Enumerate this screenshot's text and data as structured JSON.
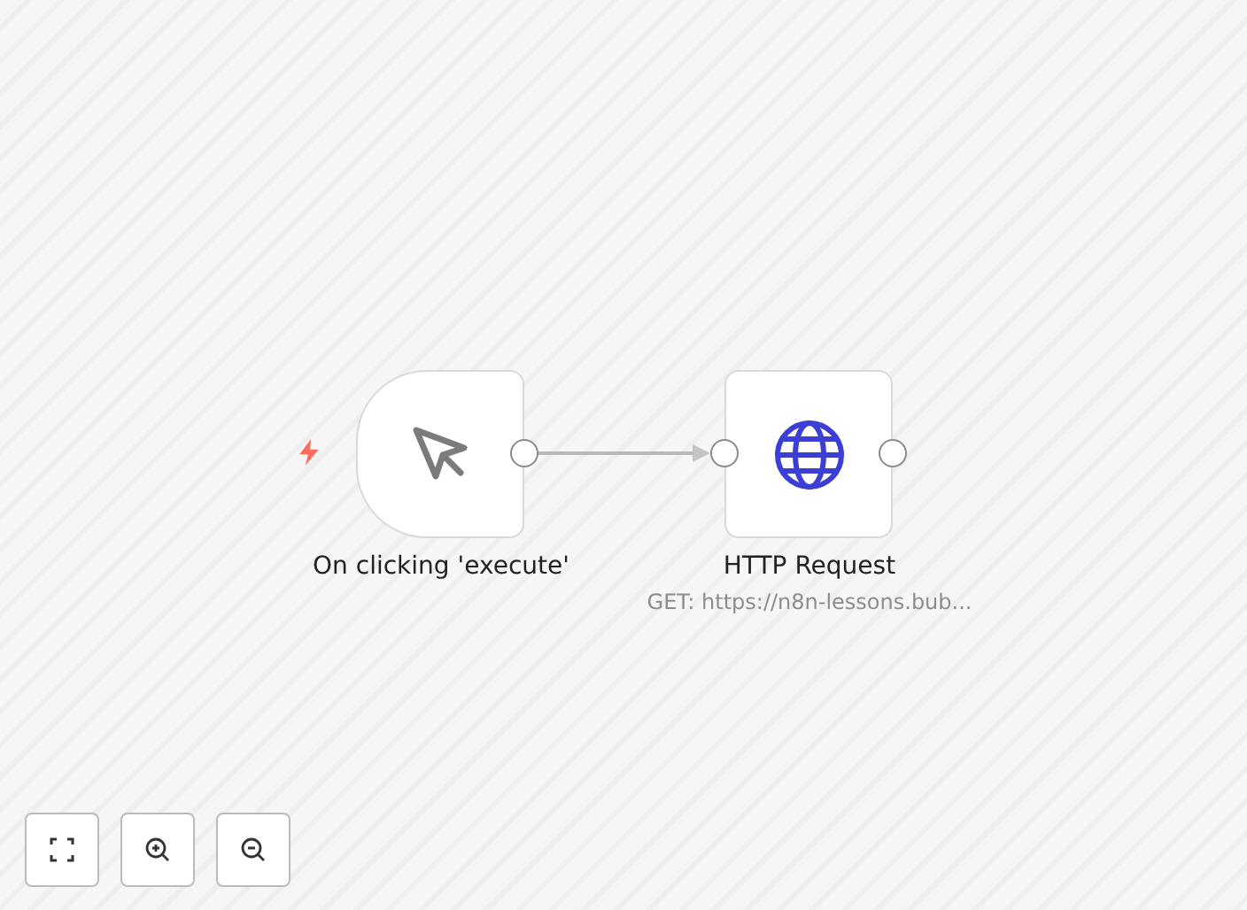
{
  "nodes": [
    {
      "kind": "manual-trigger",
      "label": "On clicking 'execute'",
      "trigger": true,
      "connected_to_next": true
    },
    {
      "kind": "http",
      "label": "HTTP Request",
      "subtitle": "GET: https://n8n-lessons.bub..."
    }
  ],
  "controls": [
    {
      "kind": "fit"
    },
    {
      "kind": "zoom-in"
    },
    {
      "kind": "zoom-out"
    }
  ]
}
